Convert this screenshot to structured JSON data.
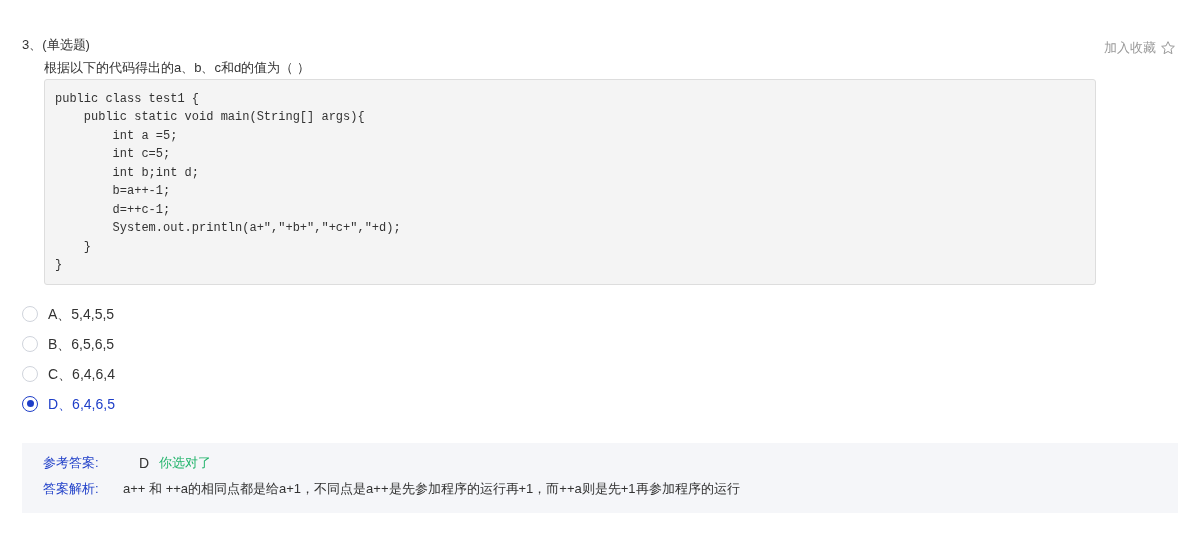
{
  "question": {
    "number": "3、",
    "type": "(单选题)",
    "stem": "根据以下的代码得出的a、b、c和d的值为（ ）",
    "favorite": {
      "label": "加入收藏",
      "on": false
    },
    "code": [
      "public class test1 {",
      "    public static void main(String[] args){",
      "        int a =5;",
      "        int c=5;",
      "        int b;int d;",
      "        b=a++-1;",
      "        d=++c-1;",
      "        System.out.println(a+\",\"+b+\",\"+c+\",\"+d);",
      "    }",
      "}"
    ]
  },
  "options": [
    {
      "label": "A、5,4,5,5",
      "selected": false
    },
    {
      "label": "B、6,5,6,5",
      "selected": false
    },
    {
      "label": "C、6,4,6,4",
      "selected": false
    },
    {
      "label": "D、6,4,6,5",
      "selected": true
    }
  ],
  "answer": {
    "label": "参考答案:",
    "value": "D",
    "verdict": "你选对了",
    "correct": true
  },
  "analysis": {
    "label": "答案解析:",
    "text": "a++ 和 ++a的相同点都是给a+1，不同点是a++是先参加程序的运行再+1，而++a则是先+1再参加程序的运行"
  }
}
